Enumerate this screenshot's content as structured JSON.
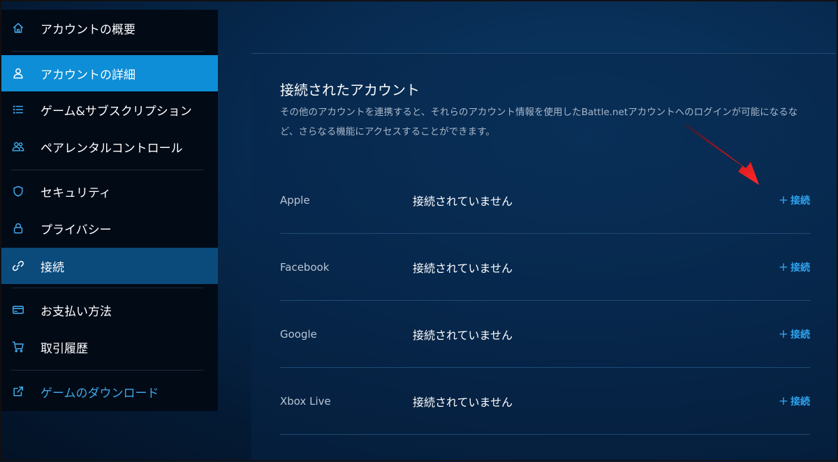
{
  "sidebar": {
    "items": [
      {
        "label": "アカウントの概要",
        "icon": "home-icon"
      },
      {
        "label": "アカウントの詳細",
        "icon": "user-icon"
      },
      {
        "label": "ゲーム&サブスクリプション",
        "icon": "list-icon"
      },
      {
        "label": "ペアレンタルコントロール",
        "icon": "users-icon"
      },
      {
        "label": "セキュリティ",
        "icon": "shield-icon"
      },
      {
        "label": "プライバシー",
        "icon": "lock-icon"
      },
      {
        "label": "接続",
        "icon": "link-icon"
      },
      {
        "label": "お支払い方法",
        "icon": "credit-card-icon"
      },
      {
        "label": "取引履歴",
        "icon": "cart-icon"
      },
      {
        "label": "ゲームのダウンロード",
        "icon": "external-link-icon"
      }
    ],
    "active_primary": "アカウントの詳細",
    "active_secondary": "接続"
  },
  "panel": {
    "title": "接続されたアカウント",
    "description": "その他のアカウントを連携すると、それらのアカウント情報を使用したBattle.netアカウントへのログインが可能になるなど、さらなる機能にアクセスすることができます。",
    "connect_plus": "+",
    "rows": [
      {
        "service": "Apple",
        "status": "接続されていません",
        "action": "接続"
      },
      {
        "service": "Facebook",
        "status": "接続されていません",
        "action": "接続"
      },
      {
        "service": "Google",
        "status": "接続されていません",
        "action": "接続"
      },
      {
        "service": "Xbox Live",
        "status": "接続されていません",
        "action": "接続"
      }
    ]
  },
  "colors": {
    "accent": "#0e8ed6",
    "link": "#2fa3ee",
    "active_secondary": "#0a4b7c",
    "annotation_arrow": "#e0161c"
  }
}
